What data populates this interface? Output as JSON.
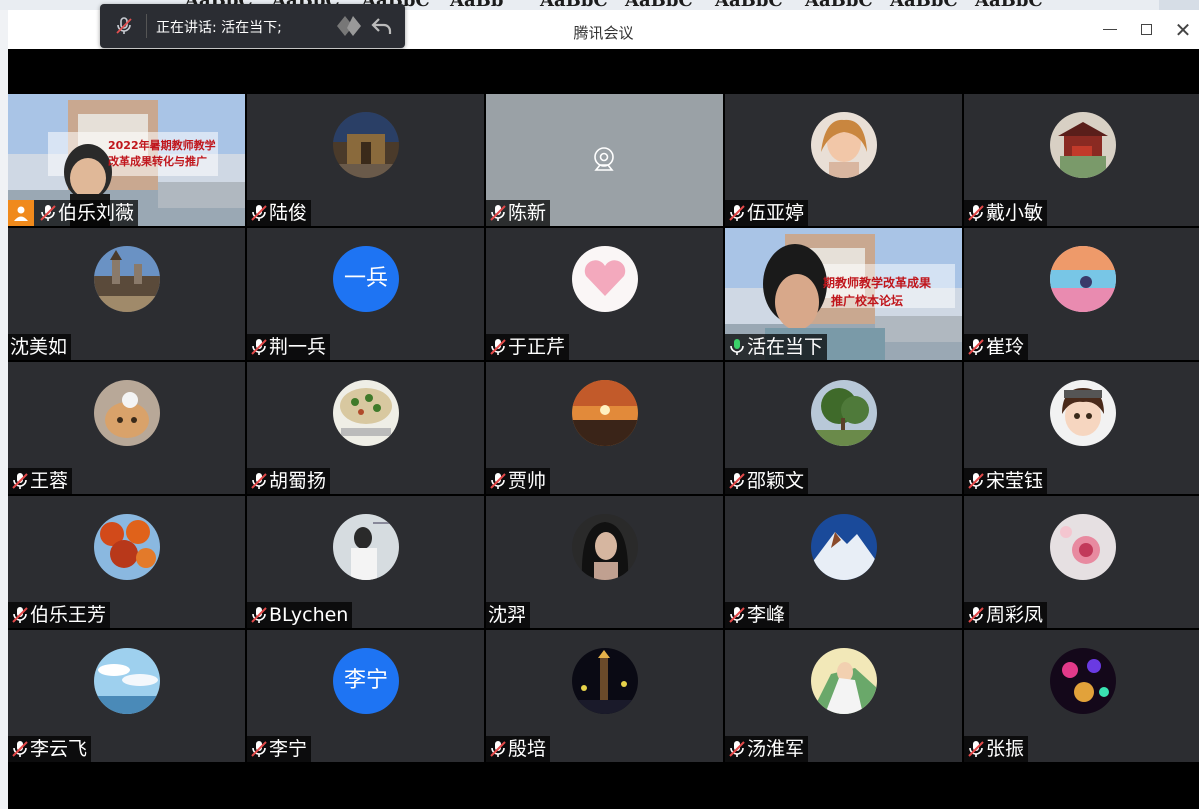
{
  "word_toolbar": {
    "style_samples": [
      "AaBbC",
      "AaBbC",
      "AaBbC",
      "AaBb",
      "AaBbC",
      "AaBbC",
      "AaBbC",
      "AaBbC",
      "AaBbC",
      "AaBbC"
    ]
  },
  "window": {
    "title": "腾讯会议",
    "controls": [
      "minimize-icon",
      "maximize-icon",
      "close-icon"
    ]
  },
  "speaker_bar": {
    "label": "正在讲话: 活在当下;"
  },
  "slide_text": {
    "host_slide": "2022年暑期教师教学改革成果转化与推广",
    "speaker_slide_line1": "期教师教学改革成果",
    "speaker_slide_line2": "推广校本论坛"
  },
  "participants": [
    {
      "name": "伯乐刘薇",
      "muted": true,
      "host": true,
      "type": "video"
    },
    {
      "name": "陆俊",
      "muted": true,
      "type": "avatar",
      "avatar": "palace-photo"
    },
    {
      "name": "陈新",
      "muted": true,
      "type": "camera-off"
    },
    {
      "name": "伍亚婷",
      "muted": true,
      "type": "avatar",
      "avatar": "woman-portrait"
    },
    {
      "name": "戴小敏",
      "muted": true,
      "type": "avatar",
      "avatar": "pavilion-photo"
    },
    {
      "name": "沈美如",
      "muted": false,
      "type": "avatar",
      "avatar": "castle-photo"
    },
    {
      "name": "荆一兵",
      "muted": true,
      "type": "text-avatar",
      "avatar_text": "一兵"
    },
    {
      "name": "于正芹",
      "muted": true,
      "type": "avatar",
      "avatar": "heart-photo"
    },
    {
      "name": "活在当下",
      "muted": false,
      "speaking": true,
      "type": "video"
    },
    {
      "name": "崔玲",
      "muted": true,
      "type": "avatar",
      "avatar": "painting-photo"
    },
    {
      "name": "王蓉",
      "muted": true,
      "type": "avatar",
      "avatar": "cat-photo"
    },
    {
      "name": "胡蜀扬",
      "muted": true,
      "type": "avatar",
      "avatar": "food-photo"
    },
    {
      "name": "贾帅",
      "muted": true,
      "type": "avatar",
      "avatar": "sunset-photo"
    },
    {
      "name": "邵颖文",
      "muted": true,
      "type": "avatar",
      "avatar": "tree-photo"
    },
    {
      "name": "宋莹钰",
      "muted": true,
      "type": "avatar",
      "avatar": "cartoon-girl"
    },
    {
      "name": "伯乐王芳",
      "muted": true,
      "type": "avatar",
      "avatar": "maple-photo"
    },
    {
      "name": "BLychen",
      "muted": true,
      "type": "avatar",
      "avatar": "person-photo"
    },
    {
      "name": "沈羿",
      "muted": false,
      "type": "avatar",
      "avatar": "woman-bw-photo"
    },
    {
      "name": "李峰",
      "muted": true,
      "type": "avatar",
      "avatar": "mountain-photo"
    },
    {
      "name": "周彩凤",
      "muted": true,
      "type": "avatar",
      "avatar": "flower-photo"
    },
    {
      "name": "李云飞",
      "muted": true,
      "type": "avatar",
      "avatar": "sky-photo"
    },
    {
      "name": "李宁",
      "muted": true,
      "type": "text-avatar",
      "avatar_text": "李宁"
    },
    {
      "name": "殷培",
      "muted": true,
      "type": "avatar",
      "avatar": "night-city-photo"
    },
    {
      "name": "汤淮军",
      "muted": true,
      "type": "avatar",
      "avatar": "dancer-photo"
    },
    {
      "name": "张振",
      "muted": true,
      "type": "avatar",
      "avatar": "fireworks-photo"
    }
  ],
  "colors": {
    "tile_bg": "#2c2d31",
    "accent_blue": "#1e74f3",
    "host_orange": "#f08a1c",
    "speaking_green": "#3bd26a"
  }
}
